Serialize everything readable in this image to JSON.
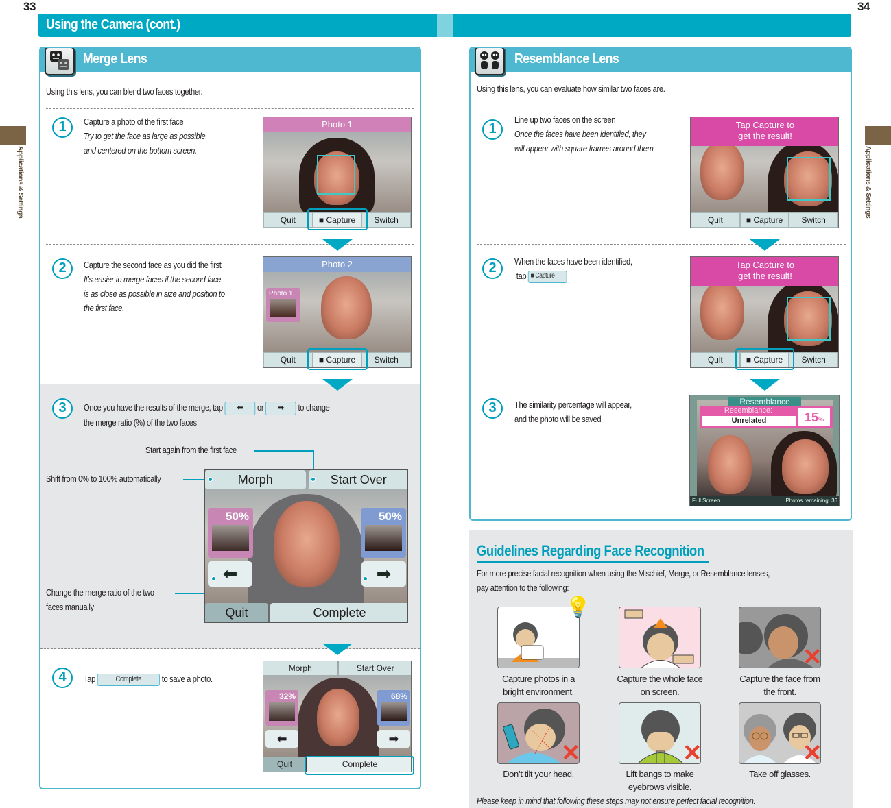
{
  "page_numbers": {
    "left": "33",
    "right": "34"
  },
  "header": {
    "title": "Using the Camera (cont.)"
  },
  "side_label": "Applications & Settings",
  "merge": {
    "title": "Merge Lens",
    "intro": "Using this lens, you can blend two faces together.",
    "steps": [
      {
        "num": "1",
        "title": "Capture a photo of the first face",
        "notes": [
          "Try to get the face as large as possible",
          "and centered on the bottom screen."
        ]
      },
      {
        "num": "2",
        "title": "Capture the second face as you did the first",
        "notes": [
          "It’s easier to merge faces if the second face",
          "is as close as possible in size and position to",
          "the first face."
        ]
      },
      {
        "num": "3",
        "text_a": "Once you have the results of the merge, tap",
        "text_or": "or",
        "text_b": "to change",
        "text_c": "the merge ratio (%) of the two faces"
      },
      {
        "num": "4",
        "text_a": "Tap",
        "btn": "Complete",
        "text_b": "to save a photo."
      }
    ],
    "callouts": {
      "start_over": "Start again from the first face",
      "morph": "Shift from 0% to 100% automatically",
      "manual": [
        "Change the merge ratio of the two",
        "faces manually"
      ]
    },
    "screen1": {
      "banner": "Photo 1",
      "buttons": [
        "Quit",
        "Capture",
        "Switch"
      ]
    },
    "screen2": {
      "banner": "Photo 2",
      "thumb_label": "Photo 1",
      "buttons": [
        "Quit",
        "Capture",
        "Switch"
      ]
    },
    "screen3": {
      "top_buttons": [
        "Morph",
        "Start Over"
      ],
      "left_pct": "50%",
      "right_pct": "50%",
      "bottom_buttons": [
        "Quit",
        "Complete"
      ]
    },
    "screen4": {
      "top_buttons": [
        "Morph",
        "Start Over"
      ],
      "left_pct": "32%",
      "right_pct": "68%",
      "bottom_buttons": [
        "Quit",
        "Complete"
      ]
    }
  },
  "resemblance": {
    "title": "Resemblance Lens",
    "intro": "Using this lens, you can evaluate how similar two faces are.",
    "steps": [
      {
        "num": "1",
        "title": "Line up two faces on the screen",
        "notes": [
          "Once the faces have been identified, they",
          "will appear with square frames around them."
        ]
      },
      {
        "num": "2",
        "title": "When the faces have been identified,",
        "text_tap": "tap",
        "btn": "Capture"
      },
      {
        "num": "3",
        "lines": [
          "The similarity percentage will appear,",
          "and the photo will be saved"
        ]
      }
    ],
    "screen1": {
      "banner": [
        "Tap  Capture to",
        "get the result!"
      ],
      "buttons": [
        "Quit",
        "Capture",
        "Switch"
      ]
    },
    "screen2": {
      "banner": [
        "Tap  Capture to",
        "get the result!"
      ],
      "buttons": [
        "Quit",
        "Capture",
        "Switch"
      ]
    },
    "screen3": {
      "header": "Resemblance",
      "label": "Resemblance:",
      "verdict": "Unrelated",
      "percent": "15",
      "percent_unit": "%",
      "footer_left": "Full Screen",
      "footer_right": "Photos remaining: 36"
    }
  },
  "guidelines": {
    "title": "Guidelines Regarding Face Recognition",
    "intro": [
      "For more precise facial recognition when using the Mischief, Merge, or Resemblance lenses,",
      "pay attention to the following:"
    ],
    "items": [
      {
        "caption": [
          "Capture photos in a",
          "bright environment."
        ],
        "bad": false
      },
      {
        "caption": [
          "Capture the whole face",
          "on screen."
        ],
        "bad": false
      },
      {
        "caption": [
          "Capture the face from",
          "the front."
        ],
        "bad": true
      },
      {
        "caption": [
          "Don’t tilt your head."
        ],
        "bad": true
      },
      {
        "caption": [
          "Lift bangs to make",
          "eyebrows visible."
        ],
        "bad": true
      },
      {
        "caption": [
          "Take off glasses."
        ],
        "bad": true
      }
    ],
    "note": "Please keep in mind that following these steps may not ensure perfect facial recognition."
  },
  "colors": {
    "accent": "#00a9c3",
    "panel": "#4db8cf",
    "tab": "#7b6446",
    "error": "#e8412f"
  }
}
